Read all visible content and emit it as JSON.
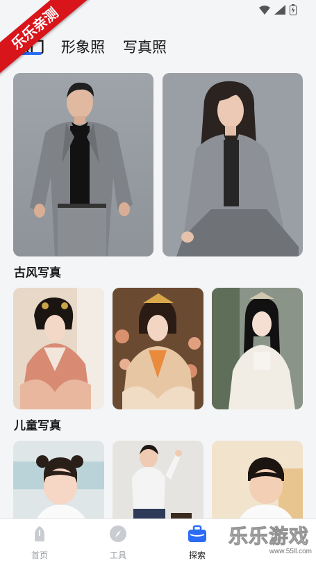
{
  "watermark": {
    "ribbon_text": "乐乐亲测",
    "brand_text": "乐乐游戏",
    "brand_url": "www.55ll.com"
  },
  "tabs": [
    {
      "label": "热门"
    },
    {
      "label": "形象照"
    },
    {
      "label": "写真照"
    }
  ],
  "sections": [
    {
      "title": "古风写真"
    },
    {
      "title": "儿童写真"
    }
  ],
  "bottom_nav": [
    {
      "label": "首页",
      "icon": "home-icon"
    },
    {
      "label": "工具",
      "icon": "compass-icon"
    },
    {
      "label": "探索",
      "icon": "briefcase-icon"
    },
    {
      "label": "",
      "icon": "profile-icon"
    }
  ],
  "colors": {
    "accent": "#2a6cf5",
    "ribbon": "#d8151b",
    "nav_inactive": "#9aa0a6"
  }
}
